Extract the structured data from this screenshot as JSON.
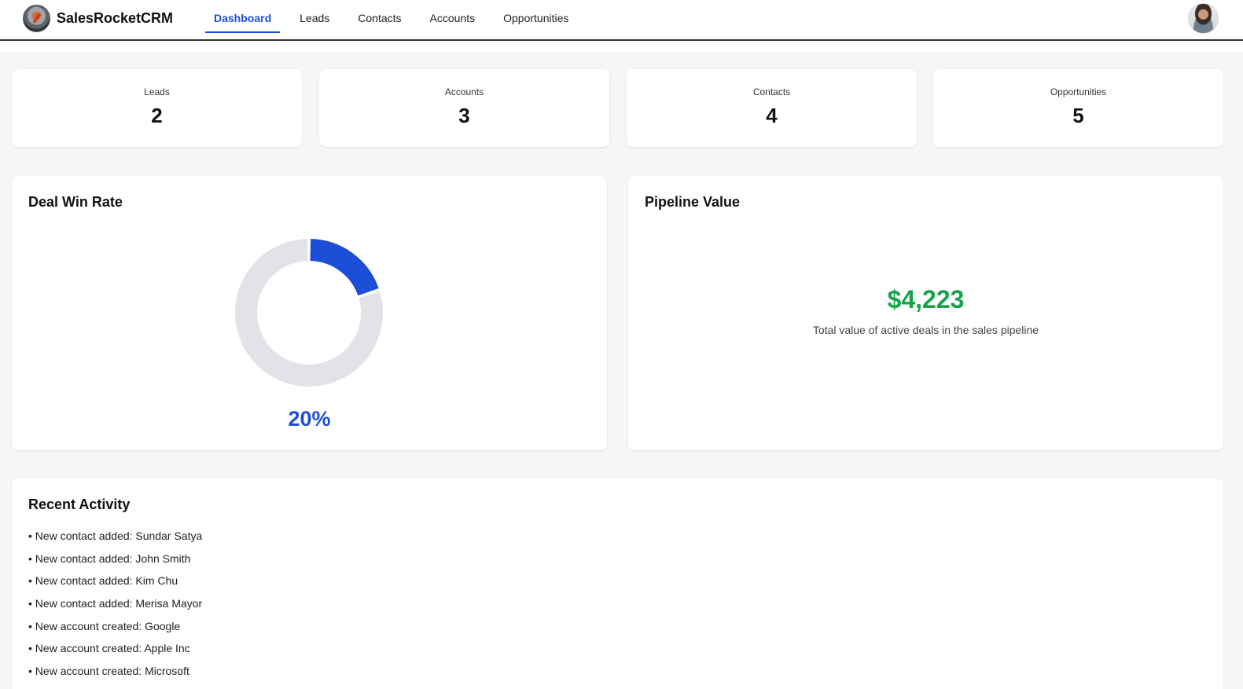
{
  "app": {
    "name": "SalesRocketCRM"
  },
  "nav": {
    "items": [
      {
        "label": "Dashboard",
        "active": true
      },
      {
        "label": "Leads",
        "active": false
      },
      {
        "label": "Contacts",
        "active": false
      },
      {
        "label": "Accounts",
        "active": false
      },
      {
        "label": "Opportunities",
        "active": false
      }
    ]
  },
  "stats": [
    {
      "label": "Leads",
      "value": "2"
    },
    {
      "label": "Accounts",
      "value": "3"
    },
    {
      "label": "Contacts",
      "value": "4"
    },
    {
      "label": "Opportunities",
      "value": "5"
    }
  ],
  "win_rate": {
    "title": "Deal Win Rate",
    "value_text": "20%",
    "fraction": 0.2,
    "colors": {
      "won": "#1d4ed8",
      "rest": "#e2e3e8"
    }
  },
  "pipeline": {
    "title": "Pipeline Value",
    "value": "$4,223",
    "description": "Total value of active deals in the sales pipeline",
    "color": "#16a34a"
  },
  "activity": {
    "title": "Recent Activity",
    "items": [
      "• New contact added: Sundar Satya",
      "• New contact added: John Smith",
      "• New contact added: Kim Chu",
      "• New contact added: Merisa Mayor",
      "• New account created: Google",
      "• New account created: Apple Inc",
      "• New account created: Microsoft"
    ]
  },
  "icons": {
    "logo": "rocket-logo-icon",
    "avatar": "user-avatar-icon"
  }
}
